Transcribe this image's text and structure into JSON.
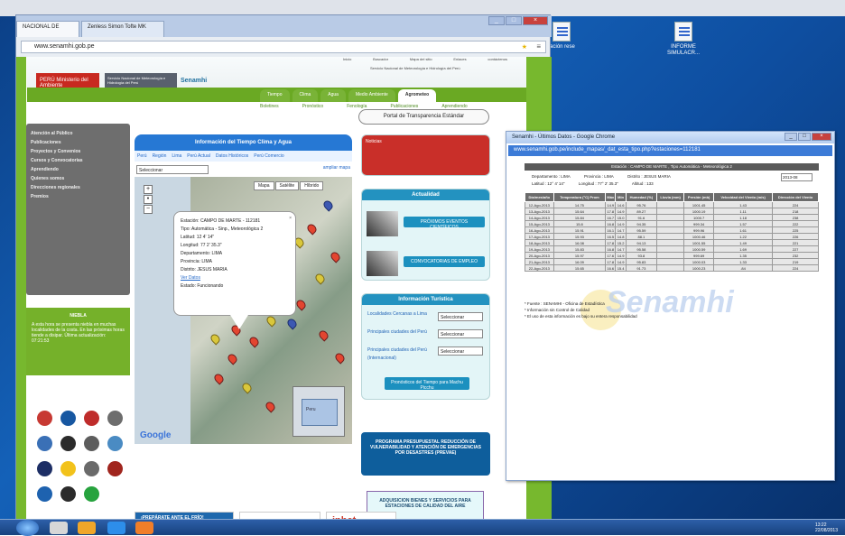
{
  "browser": {
    "tabs": [
      "NACIONAL DE",
      "Zenless Simon Tofte MK"
    ],
    "url": "www.senamhi.gob.pe"
  },
  "desktop": {
    "icons": [
      {
        "label": "ración\nrese"
      },
      {
        "label": "INFORME\nSIMULACR..."
      }
    ]
  },
  "site": {
    "top_links": [
      "Inicio",
      "Buscador",
      "Mapa del sitio",
      "Enlaces",
      "contáctenos"
    ],
    "header_title": "Servicio Nacional de Meteorología e Hidrología del Perú",
    "logo_peru": "PERÚ",
    "logo_ministerio": "Ministerio del Ambiente",
    "logo_senamhi_text": "Servicio Nacional de Meteorología e Hidrología del Perú",
    "logo_senamhi": "Senamhi",
    "nav_tabs": [
      "Tiempo",
      "Clima",
      "Agua",
      "Medio Ambiente",
      "Agrometeo"
    ],
    "sub_nav": [
      "Boletines",
      "Pronóstico",
      "Fenología",
      "Publicaciones",
      "Aprendiendo"
    ],
    "sidebar_items": [
      "Atención al Público",
      "Publicaciones",
      "Proyectos y Convenios",
      "Cursos y Convocatorias",
      "Aprendiendo",
      "Quienes somos",
      "Direcciones regionales",
      "Premios"
    ],
    "niebla_title": "NIEBLA",
    "niebla_text": "A esta hora se presenta niebla en muchas localidades de la costa. En las próximas horas tiende a disipar. Última actualización: 07:21:53",
    "portal": "Portal de Transparencia Estándar",
    "weather_title": "Información del Tiempo Clima y Agua",
    "weather_nav": [
      "Perú",
      "Región",
      "Lima",
      "Perú Actual",
      "Datos Históricos",
      "Perú Comercio"
    ],
    "selector": "Seleccionar",
    "zoom_link": "ampliar mapa",
    "map_types": [
      "Mapa",
      "Satélite",
      "Híbrido"
    ],
    "popup": {
      "estacion": "Estación: CAMPO DE MARTE - 112181",
      "tipo": "Tipo: Automática - Sinp., Meteorológica 2",
      "latitud": "Latitud: 12 4' 14\"",
      "longitud": "Longitud: 77 2' 35.3\"",
      "departamento": "Departamento: LIMA",
      "provincia": "Provincia: LIMA",
      "distrito": "Distrito: JESUS MARIA",
      "ver_datos": "Ver Datos",
      "estado": "Estado: Funcionando"
    },
    "map_label": "Peru",
    "google_label": "Google",
    "red_panel": "Noticias",
    "actualidad_title": "Actualidad",
    "news_buttons": [
      "PRÓXIMOS EVENTOS CIENTÍFICOS",
      "CONVOCATORIAS DE EMPLEO"
    ],
    "turistica_title": "Información Turística",
    "turistica_items": [
      {
        "label": "Localidades Cercanas a Lima",
        "select": "Seleccionar"
      },
      {
        "label": "Principales ciudades del Perú",
        "select": "Seleccionar"
      },
      {
        "label": "Principales ciudades del Perú (Internacional)",
        "select": "Seleccionar"
      }
    ],
    "turistica_footer": "Pronósticos del Tiempo para Machu Picchu",
    "programa": "PROGRAMA PRESUPUESTAL REDUCCIÓN DE VULNERABILIDAD Y ATENCIÓN DE EMERGENCIAS POR DESASTRES (PREVAE)",
    "adquisicion": "ADQUISICION BIENES Y SERVICIOS PARA ESTACIONES DE CALIDAD DEL AIRE",
    "bottom_logos": [
      "¡PREPÁRATE ANTE EL FRÍO!",
      "mag",
      "inhet"
    ]
  },
  "popup_window": {
    "title": "Senamhi - Últimos Datos - Google Chrome",
    "url": "www.senamhi.gob.pe/include_mapas/_dat_esta_tipo.php?estaciones=112181",
    "station_title": "Estación : CAMPO DE MARTE , Tipo Automática - Meteorológica 2",
    "meta": {
      "departamento": "Departamento : LIMA",
      "provincia": "Provincia : LIMA",
      "distrito": "Distrito : JESUS MARIA",
      "latitud": "Latitud : 12° 4' 14\"",
      "longitud": "Longitud : 77° 2' 35.3\"",
      "altitud": "Altitud : 133",
      "year": "2013-08"
    },
    "columns": [
      "Día/mes/año",
      "Temperatura (°C) Prom",
      "Máx",
      "Mín",
      "Humedad (%)",
      "Lluvia (mm)",
      "Presión (mb)",
      "Velocidad del Viento (m/s)",
      "Dirección del Viento"
    ],
    "rows": [
      [
        "12-Ago-2013",
        "14.75",
        "14.9",
        "14.6",
        "95.76",
        "",
        "1001.45",
        "1.43",
        "224"
      ],
      [
        "13-Ago-2013",
        "15.64",
        "17.8",
        "14.9",
        "89.27",
        "",
        "1000.19",
        "1.11",
        "218"
      ],
      [
        "14-Ago-2013",
        "15.84",
        "16.7",
        "15.0",
        "91.6",
        "",
        "1000.7",
        "1.18",
        "238"
      ],
      [
        "15-Ago-2013",
        "15.8",
        "16.8",
        "14.9",
        "94.35",
        "",
        "999.34",
        "1.57",
        "222"
      ],
      [
        "16-Ago-2013",
        "15.91",
        "16.1",
        "14.7",
        "95.59",
        "",
        "999.96",
        "1.61",
        "225"
      ],
      [
        "17-Ago-2013",
        "15.93",
        "16.5",
        "14.8",
        "88.1",
        "",
        "1000.46",
        "1.22",
        "226"
      ],
      [
        "18-Ago-2013",
        "16.08",
        "17.8",
        "15.2",
        "94.13",
        "",
        "1001.55",
        "1.49",
        "221"
      ],
      [
        "19-Ago-2013",
        "15.83",
        "16.8",
        "14.7",
        "95.58",
        "",
        "1000.59",
        "1.69",
        "227"
      ],
      [
        "20-Ago-2013",
        "15.97",
        "17.6",
        "14.9",
        "93.8",
        "",
        "999.69",
        "1.35",
        "232"
      ],
      [
        "21-Ago-2013",
        "16.09",
        "17.8",
        "14.9",
        "95.83",
        "",
        "1000.03",
        "1.33",
        "219"
      ],
      [
        "22-Ago-2013",
        "15.65",
        "16.6",
        "15.4",
        "91.73",
        "",
        "1000.23",
        ".84",
        "224"
      ]
    ],
    "notes": [
      "* Fuente : SENAMHI - Oficina de Estadística",
      "* Información sin Control de Calidad",
      "* El uso de esta información es bajo su entera responsabilidad"
    ],
    "watermark": "Senamhi"
  },
  "taskbar": {
    "tray_time": "13:22",
    "tray_date": "22/08/2013"
  }
}
